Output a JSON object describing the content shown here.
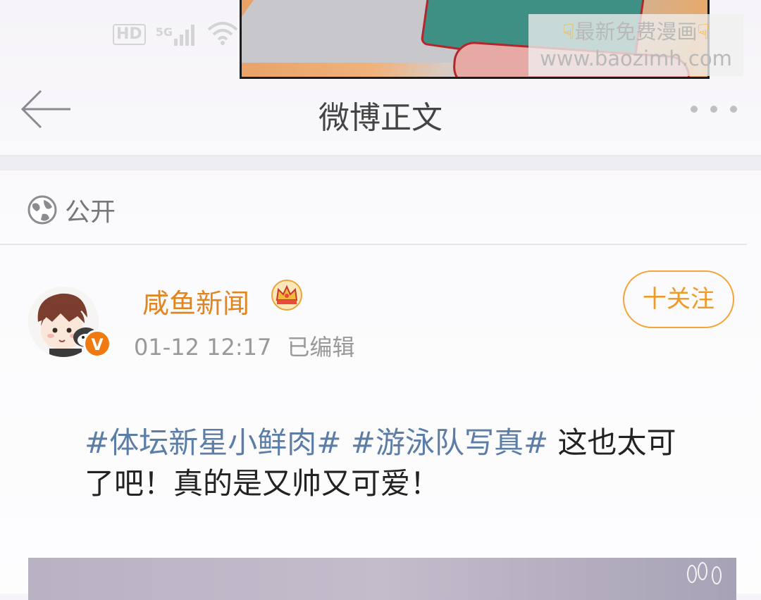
{
  "status_bar": {
    "hd": "HD",
    "network": "5G",
    "icons": [
      "signal-bars",
      "wifi"
    ]
  },
  "watermark": {
    "line1": "最新免费漫画",
    "line2": "www.baozimh.com",
    "icon": "pointing-down-hand"
  },
  "nav": {
    "title": "微博正文",
    "back_icon": "arrow-left",
    "more_icon": "more-dots"
  },
  "visibility": {
    "icon": "globe",
    "label": "公开"
  },
  "post": {
    "author": "咸鱼新闻",
    "crown_icon": "crown",
    "verified_badge": "V",
    "timestamp": "01-12 12:17",
    "edited": "已编辑",
    "follow_label": "十关注",
    "topic1": "#体坛新星小鲜肉#",
    "topic2": "#游泳队写真#",
    "text": "这也太可了吧！真的是又帅又可爱！"
  },
  "colors": {
    "accent": "#f09a2a",
    "username": "#e08520",
    "topic": "#5c7da6"
  }
}
